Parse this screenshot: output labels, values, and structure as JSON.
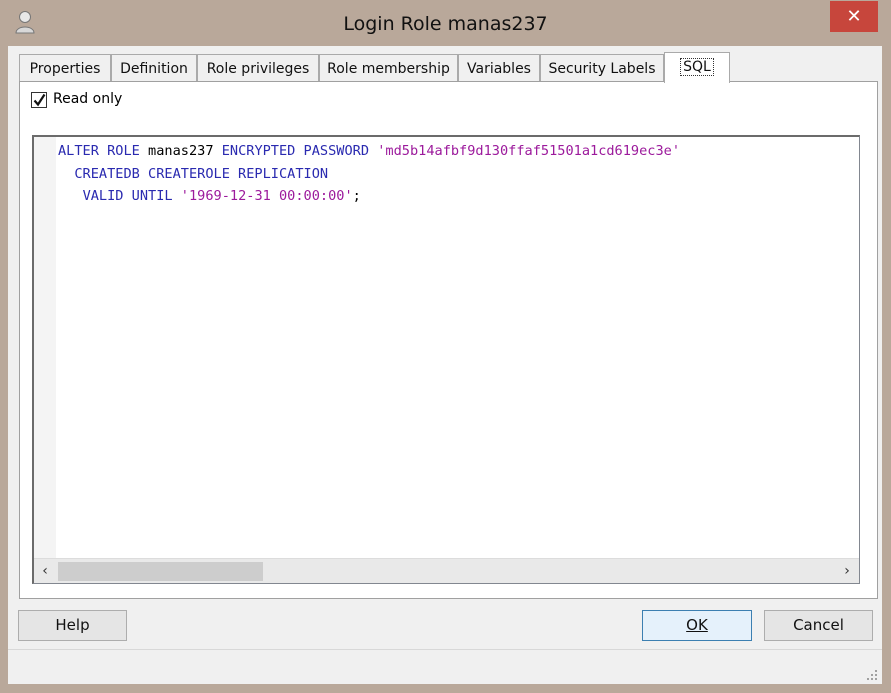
{
  "window": {
    "title": "Login Role manas237",
    "close_label": "✕",
    "app_icon": "user-icon"
  },
  "tabs": [
    {
      "label": "Properties",
      "active": false
    },
    {
      "label": "Definition",
      "active": false
    },
    {
      "label": "Role privileges",
      "active": false
    },
    {
      "label": "Role membership",
      "active": false
    },
    {
      "label": "Variables",
      "active": false
    },
    {
      "label": "Security Labels",
      "active": false
    },
    {
      "label": "SQL",
      "active": true
    }
  ],
  "sql_tab": {
    "read_only_label": "Read only",
    "read_only_checked": true,
    "code": {
      "line1": {
        "kw1": "ALTER ROLE",
        "id": "manas237",
        "kw2": "ENCRYPTED PASSWORD",
        "str": "'md5b14afbf9d130ffaf51501a1cd619ec3e'"
      },
      "line2": {
        "kw": "CREATEDB CREATEROLE REPLICATION"
      },
      "line3": {
        "kw": "VALID UNTIL",
        "str": "'1969-12-31 00:00:00'",
        "end": ";"
      }
    }
  },
  "scrollbar": {
    "left_arrow": "‹",
    "right_arrow": "›"
  },
  "buttons": {
    "help": "Help",
    "ok": "OK",
    "cancel": "Cancel"
  },
  "colors": {
    "keyword": "#2a2ab0",
    "string": "#9c1a9c",
    "close_button": "#c7463c",
    "frame": "#b9a89a"
  }
}
